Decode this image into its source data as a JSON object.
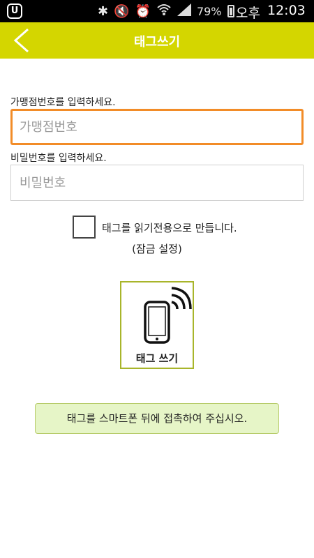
{
  "status_bar": {
    "battery_percent": "79%",
    "ampm": "오후",
    "time": "12:03",
    "icons": [
      "app-u-icon",
      "bluetooth-icon",
      "mute-icon",
      "alarm-icon",
      "wifi-icon",
      "signal-icon",
      "battery-icon"
    ]
  },
  "header": {
    "title": "태그쓰기",
    "back_icon": "chevron-left-icon",
    "color": "#d4d600"
  },
  "form": {
    "store_label": "가맹점번호를 입력하세요.",
    "store_placeholder": "가맹점번호",
    "store_value": "",
    "password_label": "비밀번호를 입력하세요.",
    "password_placeholder": "비밀번호",
    "password_value": "",
    "readonly_label": "태그를 읽기전용으로 만듭니다.",
    "readonly_sub": "(잠금 설정)",
    "readonly_checked": false
  },
  "tag_button": {
    "label": "태그 쓰기",
    "icon": "smartphone-nfc-icon"
  },
  "notice": {
    "text": "태그를 스마트폰 뒤에 접촉하여 주십시오."
  }
}
